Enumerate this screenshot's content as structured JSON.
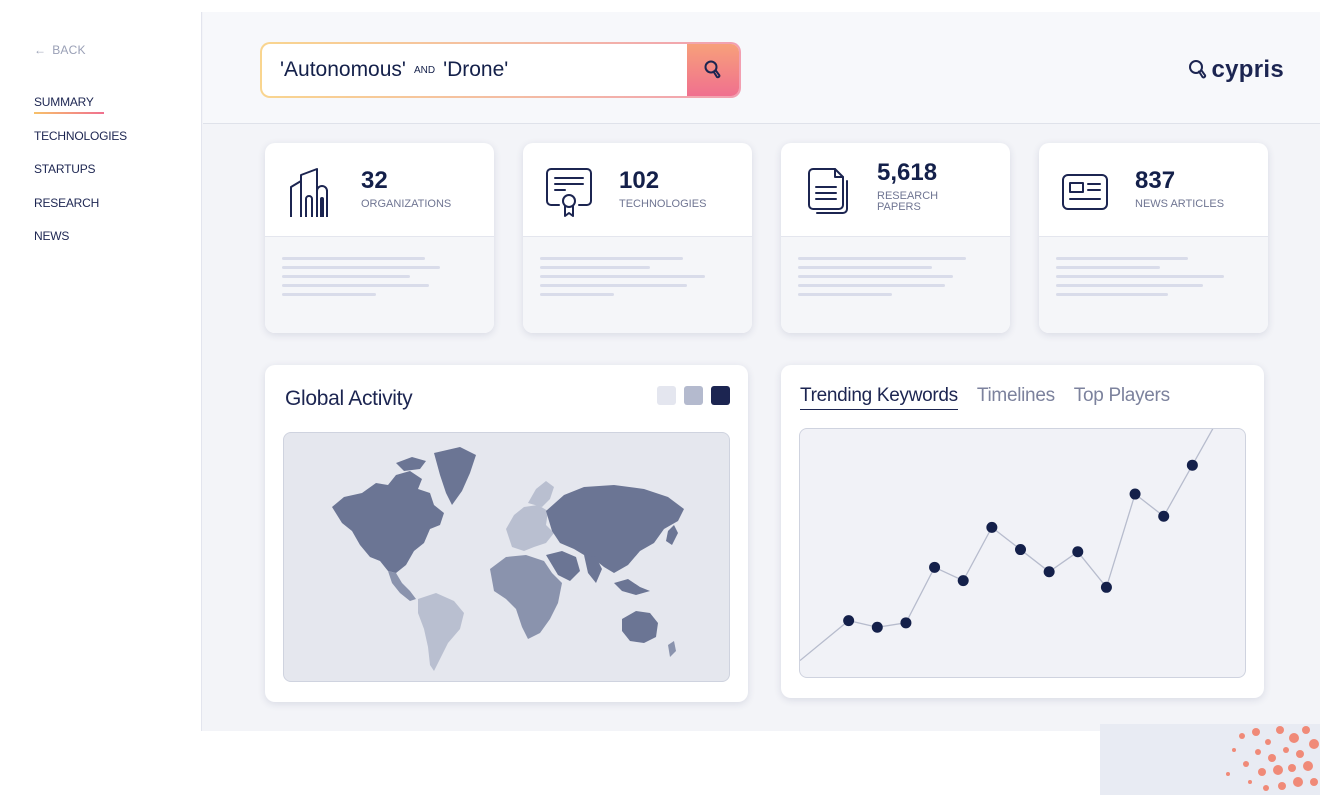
{
  "sidebar": {
    "back_label": "BACK",
    "items": [
      {
        "label": "SUMMARY",
        "active": true
      },
      {
        "label": "TECHNOLOGIES"
      },
      {
        "label": "STARTUPS"
      },
      {
        "label": "RESEARCH"
      },
      {
        "label": "NEWS"
      }
    ]
  },
  "search": {
    "term1": "'Autonomous'",
    "operator": "AND",
    "term2": "'Drone'",
    "button_icon": "search-icon"
  },
  "logo": {
    "text": "cypris",
    "icon": "search-icon"
  },
  "stats": [
    {
      "value": "32",
      "label": "ORGANIZATIONS",
      "icon": "buildings-icon"
    },
    {
      "value": "102",
      "label": "TECHNOLOGIES",
      "icon": "certificate-icon"
    },
    {
      "value": "5,618",
      "label_line1": "RESEARCH",
      "label_line2": "PAPERS",
      "icon": "document-icon"
    },
    {
      "value": "837",
      "label": "NEWS ARTICLES",
      "icon": "newspaper-icon"
    }
  ],
  "global_activity": {
    "title": "Global Activity",
    "legend_colors": [
      "#e4e6ef",
      "#b4bace",
      "#1c2551"
    ],
    "map_colors": {
      "high": "#6b7594",
      "medium": "#8a93ad",
      "low": "#b9bfd0"
    }
  },
  "trends": {
    "tabs": [
      {
        "label": "Trending Keywords",
        "active": true
      },
      {
        "label": "Timelines"
      },
      {
        "label": "Top Players"
      }
    ]
  },
  "chart_data": {
    "type": "line",
    "title": "",
    "xlabel": "",
    "ylabel": "",
    "x": [
      1,
      2,
      3,
      4,
      5,
      6,
      7,
      8,
      9,
      10,
      11,
      12,
      13,
      14
    ],
    "series": [
      {
        "values": [
          2.0,
          1.7,
          1.9,
          4.4,
          3.8,
          6.2,
          5.2,
          4.2,
          5.1,
          3.5,
          7.7,
          6.7,
          9.0,
          null
        ]
      }
    ],
    "ylim": [
      0,
      10
    ],
    "grid": false,
    "line_color": "#b7bccd",
    "marker_color": "#14204a"
  }
}
